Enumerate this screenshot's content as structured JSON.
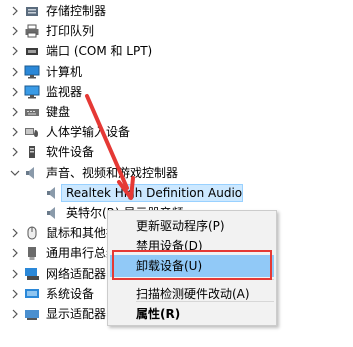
{
  "tree": {
    "items": [
      {
        "label": "存储控制器",
        "icon": "storage-controller-icon",
        "expanded": false
      },
      {
        "label": "打印队列",
        "icon": "printer-icon",
        "expanded": false
      },
      {
        "label": "端口 (COM 和 LPT)",
        "icon": "port-icon",
        "expanded": false
      },
      {
        "label": "计算机",
        "icon": "computer-icon",
        "expanded": false
      },
      {
        "label": "监视器",
        "icon": "monitor-icon",
        "expanded": false
      },
      {
        "label": "键盘",
        "icon": "keyboard-icon",
        "expanded": false
      },
      {
        "label": "人体学输入设备",
        "icon": "hid-icon",
        "expanded": false
      },
      {
        "label": "软件设备",
        "icon": "software-device-icon",
        "expanded": false
      },
      {
        "label": "声音、视频和游戏控制器",
        "icon": "speaker-icon",
        "expanded": true
      },
      {
        "label": "Realtek High Definition Audio",
        "icon": "speaker-icon",
        "child": true,
        "selected": true
      },
      {
        "label": "英特尔(R) 显示器音频",
        "icon": "speaker-icon",
        "child": true
      },
      {
        "label": "鼠标和其他指针设备",
        "icon": "mouse-icon",
        "expanded": false
      },
      {
        "label": "通用串行总线控制器",
        "icon": "usb-icon",
        "expanded": false
      },
      {
        "label": "网络适配器",
        "icon": "network-adapter-icon",
        "expanded": false
      },
      {
        "label": "系统设备",
        "icon": "system-device-icon",
        "expanded": false
      },
      {
        "label": "显示适配器",
        "icon": "display-adapter-icon",
        "expanded": false
      }
    ]
  },
  "context_menu": {
    "items": [
      {
        "label": "更新驱动程序(P)"
      },
      {
        "label": "禁用设备(D)"
      },
      {
        "label": "卸载设备(U)",
        "hover": true
      },
      {
        "label": "扫描检测硬件改动(A)"
      },
      {
        "label": "属性(R)",
        "bold": true
      }
    ]
  },
  "colors": {
    "highlight": "#e53935",
    "menu_hover": "#91c9f7",
    "selection": "#cce8ff"
  }
}
